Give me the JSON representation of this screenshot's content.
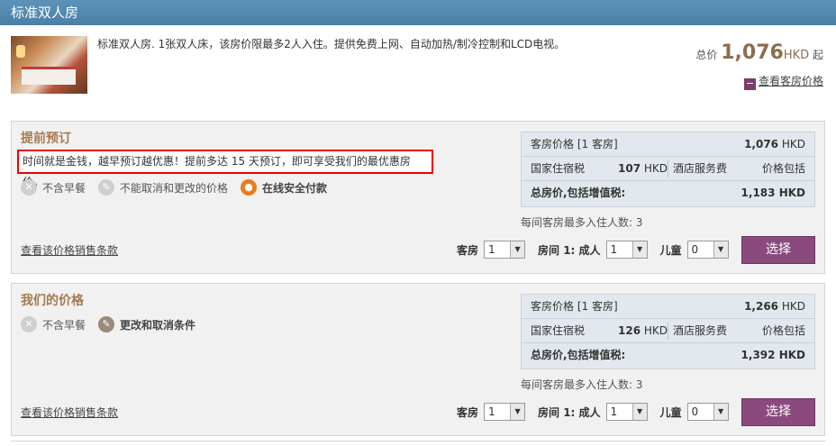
{
  "header": {
    "title": "标准双人房"
  },
  "room": {
    "description": "标准双人房. 1张双人床，该房价限最多2人入住。提供免费上网、自动加热/制冷控制和LCD电视。",
    "total_label": "总价",
    "total_value": "1,076",
    "total_currency": "HKD",
    "total_suffix": "起",
    "view_prices_icon": "−",
    "view_prices_label": "查看客房价格"
  },
  "rates": [
    {
      "title": "提前预订",
      "notice": "时间就是金钱，越早预订越优惠！提前多达 15 天预订，即可享受我们的最优惠房价。",
      "features": [
        {
          "icon": "fork-knife-icon",
          "glyph": "🍴",
          "label": "不含早餐"
        },
        {
          "icon": "no-cancel-icon",
          "glyph": "✎",
          "label": "不能取消和更改的价格"
        },
        {
          "icon": "lock-icon",
          "glyph": "🔒",
          "label": "在线安全付款"
        }
      ],
      "terms_link": "查看该价格销售条款",
      "price_box": {
        "room_price_label": "客房价格 [1 客房]",
        "room_price_value": "1,076",
        "room_price_currency": "HKD",
        "tax_label": "国家住宿税",
        "tax_value": "107",
        "tax_currency": "HKD",
        "service_label": "酒店服务费",
        "service_value": "价格包括",
        "total_label": "总房价,包括增值税:",
        "total_value": "1,183",
        "total_currency": "HKD"
      },
      "max_occupancy": "每间客房最多入住人数: 3",
      "rooms_label": "客房",
      "rooms_value": "1",
      "adults_label": "房间 1: 成人",
      "adults_value": "1",
      "children_label": "儿童",
      "children_value": "0",
      "select_button": "选择"
    },
    {
      "title": "我们的价格",
      "features": [
        {
          "icon": "fork-knife-icon",
          "glyph": "🍴",
          "label": "不含早餐"
        },
        {
          "icon": "change-cancel-icon",
          "glyph": "✎",
          "label": "更改和取消条件"
        }
      ],
      "terms_link": "查看该价格销售条款",
      "price_box": {
        "room_price_label": "客房价格 [1 客房]",
        "room_price_value": "1,266",
        "room_price_currency": "HKD",
        "tax_label": "国家住宿税",
        "tax_value": "126",
        "tax_currency": "HKD",
        "service_label": "酒店服务费",
        "service_value": "价格包括",
        "total_label": "总房价,包括增值税:",
        "total_value": "1,392",
        "total_currency": "HKD"
      },
      "max_occupancy": "每间客房最多入住人数: 3",
      "rooms_label": "客房",
      "rooms_value": "1",
      "adults_label": "房间 1: 成人",
      "adults_value": "1",
      "children_label": "儿童",
      "children_value": "0",
      "select_button": "选择"
    }
  ],
  "colors": {
    "header_bg": "#5187ad",
    "accent_price": "#8c6d4e",
    "button": "#8a4a7e",
    "notice_border": "#ee0000"
  }
}
